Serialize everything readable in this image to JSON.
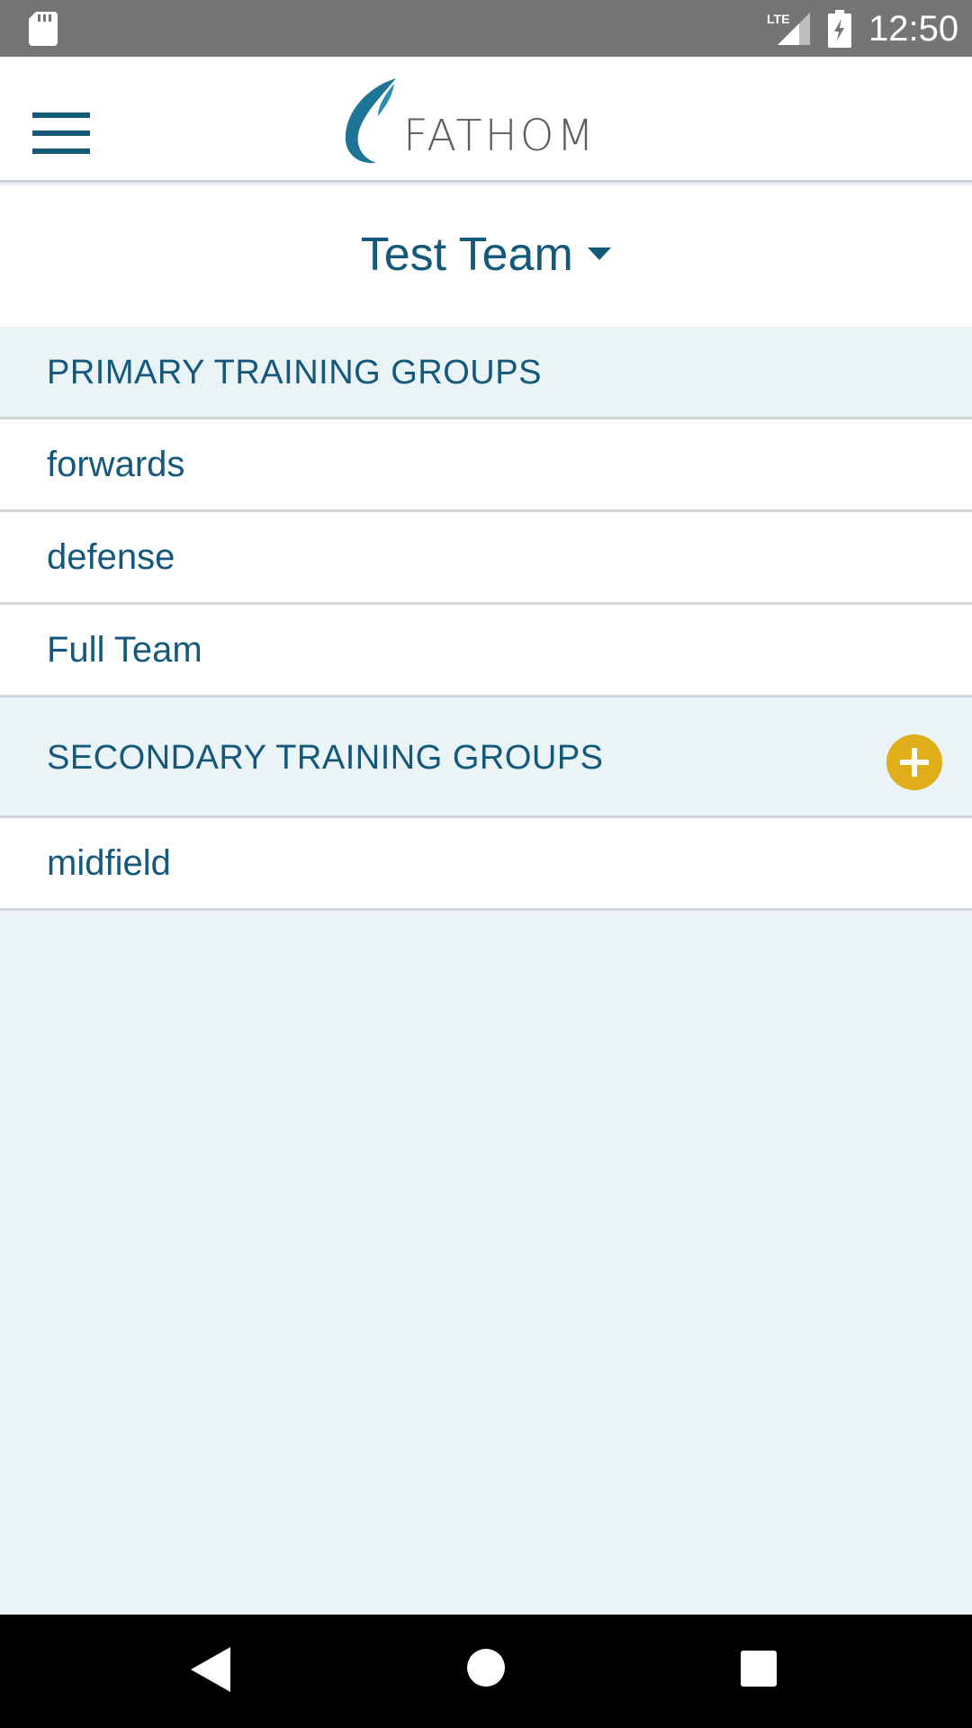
{
  "status_bar": {
    "network": "LTE",
    "time": "12:50"
  },
  "app_bar": {
    "brand": "FATHOM"
  },
  "team": {
    "name": "Test Team"
  },
  "primary_groups": {
    "title": "PRIMARY TRAINING GROUPS",
    "items": [
      {
        "label": "forwards"
      },
      {
        "label": "defense"
      },
      {
        "label": "Full Team"
      }
    ]
  },
  "secondary_groups": {
    "title": "SECONDARY TRAINING GROUPS",
    "items": [
      {
        "label": "midfield"
      }
    ]
  },
  "colors": {
    "accent": "#14587a",
    "add_button": "#e0ad1b",
    "section_bg": "#eaf3f6",
    "status_bar": "#757575"
  },
  "icons": {
    "menu": "hamburger-menu-icon",
    "add": "plus-circle-icon",
    "caret": "caret-down-icon",
    "back": "back-triangle-icon",
    "home": "home-circle-icon",
    "recent": "recent-square-icon"
  }
}
